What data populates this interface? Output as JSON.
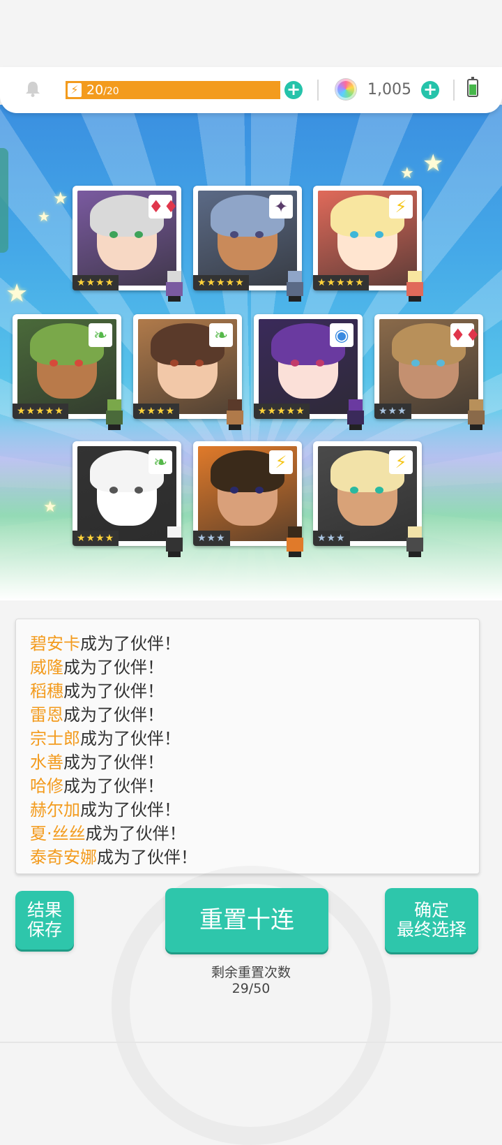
{
  "header": {
    "stamina_current": "20",
    "stamina_max": "/20",
    "stamina_fraction": 1.0,
    "gems": "1,005"
  },
  "cards": [
    {
      "name": "碧安卡",
      "element": "red-diamonds",
      "stars": "★★★★",
      "rank": "gold",
      "hair": "#d9d9d9",
      "skin": "#f7d8c4",
      "bg": "#7a5aa0",
      "eye": "#3ea35a",
      "elem_color": "#e0364b"
    },
    {
      "name": "威隆",
      "element": "dark-star",
      "stars": "★★★★★",
      "rank": "gold",
      "hair": "#8fa5c8",
      "skin": "#c98a5a",
      "bg": "#5b6a86",
      "eye": "#4a4a7a",
      "elem_color": "#5a3d6b"
    },
    {
      "name": "稻穗",
      "element": "lightning",
      "stars": "★★★★★",
      "rank": "gold",
      "hair": "#f8e6a0",
      "skin": "#ffe5d0",
      "bg": "#e06a5a",
      "eye": "#3fb6d8",
      "elem_color": "#f5c518"
    },
    {
      "name": "雷恩",
      "element": "leaf",
      "stars": "★★★★★",
      "rank": "gold",
      "hair": "#7aa84a",
      "skin": "#b97a4a",
      "bg": "#4a6a3a",
      "eye": "#d64a3a",
      "elem_color": "#56b84a"
    },
    {
      "name": "宗士郎",
      "element": "leaf",
      "stars": "★★★★",
      "rank": "gold",
      "hair": "#5a3a2a",
      "skin": "#f2c8a8",
      "bg": "#b07a4a",
      "eye": "#a0442a",
      "elem_color": "#56b84a"
    },
    {
      "name": "水善",
      "element": "water-orb",
      "stars": "★★★★★",
      "rank": "gold",
      "hair": "#6a3aa0",
      "skin": "#fbe0d8",
      "bg": "#3a2a5a",
      "eye": "#c23a6a",
      "elem_color": "#3a8ae0"
    },
    {
      "name": "哈修",
      "element": "red-diamonds",
      "stars": "★★★",
      "rank": "silver",
      "hair": "#b8905a",
      "skin": "#c49070",
      "bg": "#8a6a4a",
      "eye": "#5ab8d8",
      "elem_color": "#e0364b"
    },
    {
      "name": "赫尔加",
      "element": "leaf",
      "stars": "★★★★",
      "rank": "gold",
      "hair": "#f4f4f4",
      "skin": "#ffffff",
      "bg": "#333333",
      "eye": "#555555",
      "elem_color": "#56b84a"
    },
    {
      "name": "夏·丝丝",
      "element": "lightning",
      "stars": "★★★",
      "rank": "silver",
      "hair": "#3a2a1a",
      "skin": "#d9a07a",
      "bg": "#e07a2a",
      "eye": "#2a2a6a",
      "elem_color": "#f5c518"
    },
    {
      "name": "泰奇安娜",
      "element": "lightning",
      "stars": "★★★",
      "rank": "silver",
      "hair": "#f2e2a8",
      "skin": "#d8a278",
      "bg": "#4a4a4a",
      "eye": "#2ab8a0",
      "elem_color": "#f5c518"
    }
  ],
  "log": {
    "suffix": "成为了伙伴！",
    "names": [
      "碧安卡",
      "威隆",
      "稻穗",
      "雷恩",
      "宗士郎",
      "水善",
      "哈修",
      "赫尔加",
      "夏·丝丝",
      "泰奇安娜"
    ]
  },
  "buttons": {
    "save": "结果保存",
    "save_line1": "结果",
    "save_line2": "保存",
    "reset": "重置十连",
    "confirm_line1": "确定",
    "confirm_line2": "最终选择"
  },
  "remaining": {
    "label": "剩余重置次数",
    "count": "29/50"
  }
}
